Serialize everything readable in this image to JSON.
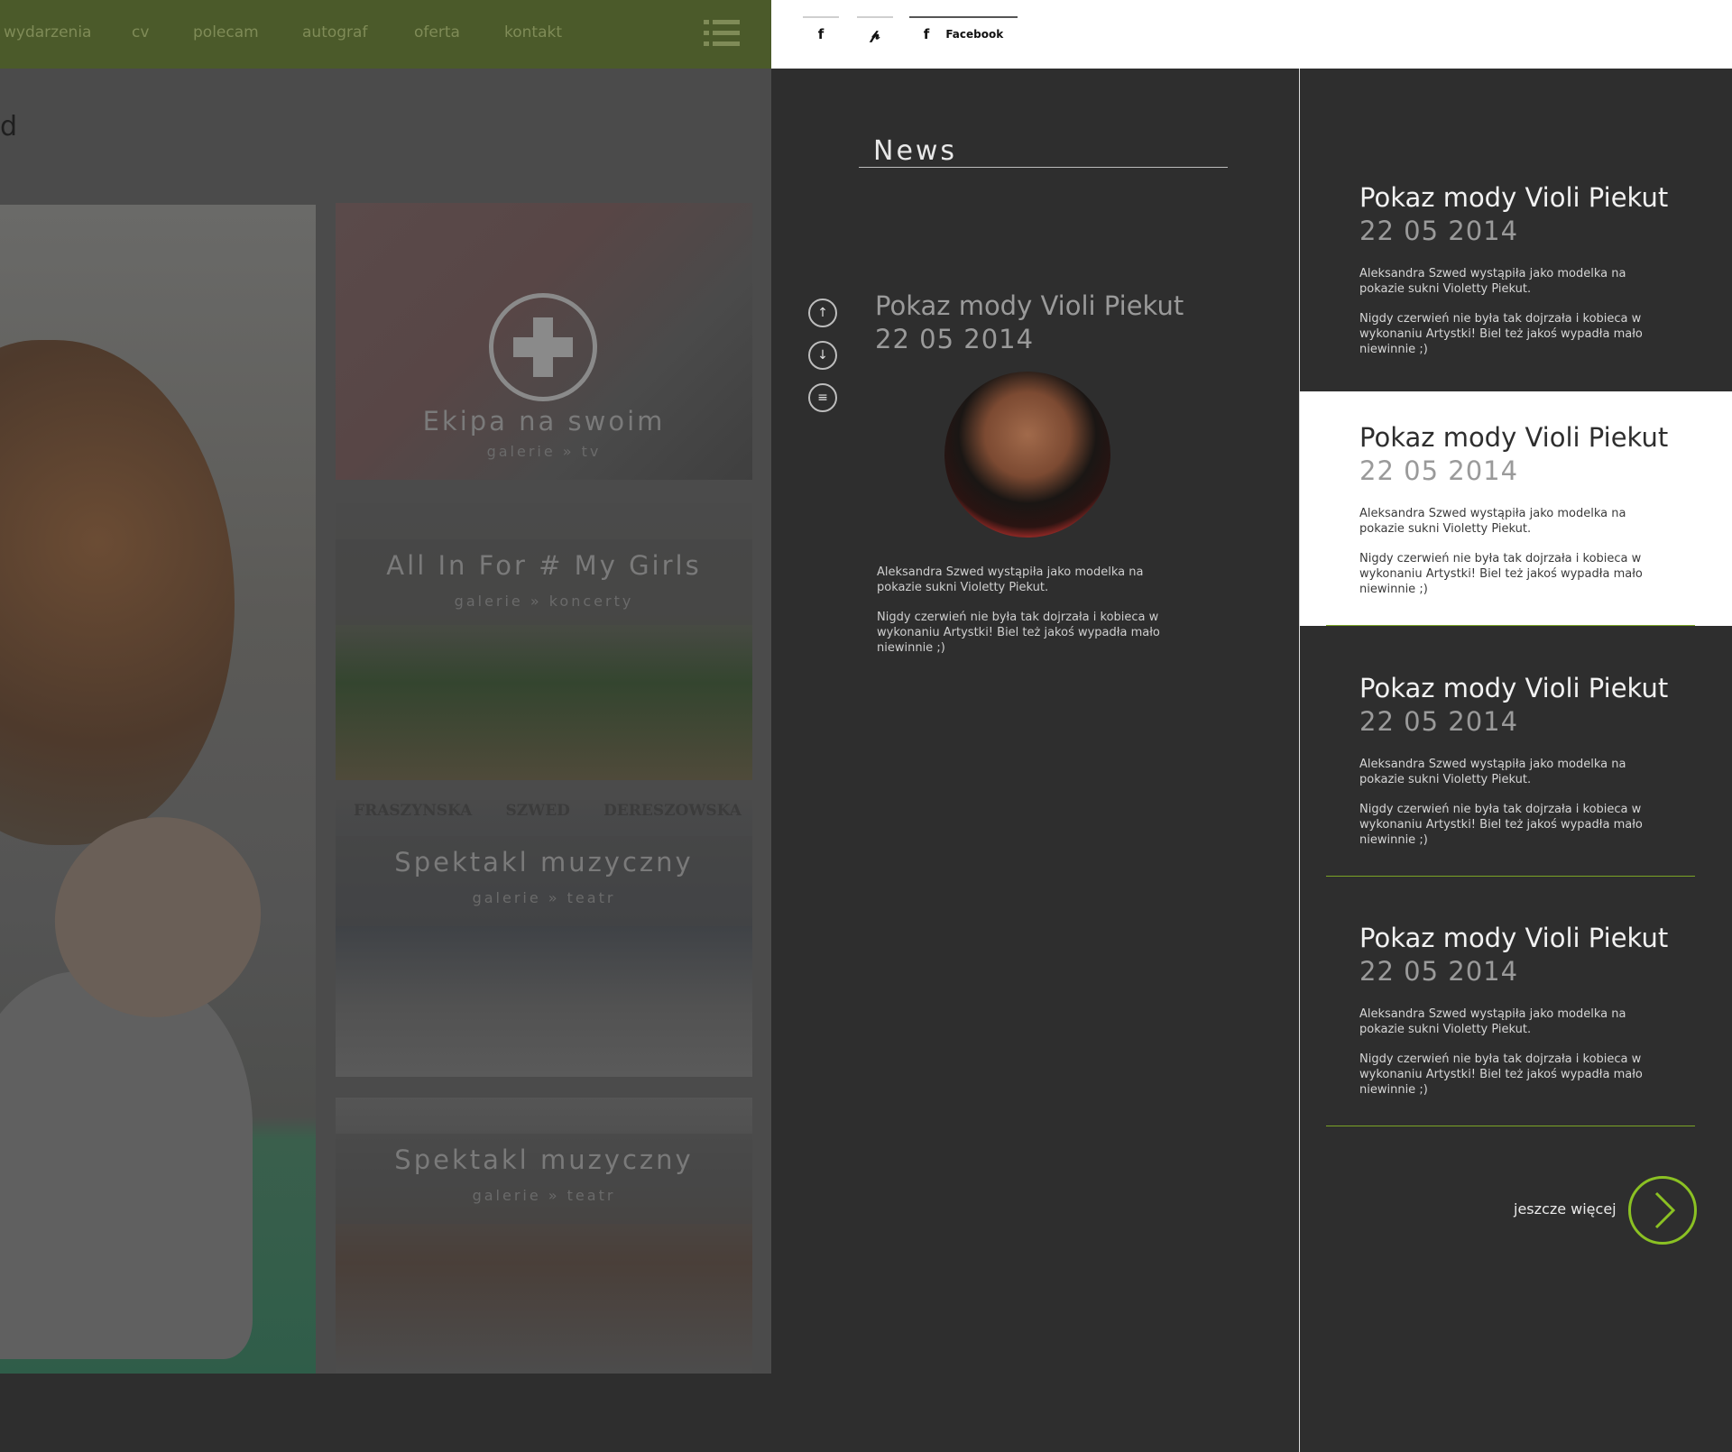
{
  "nav": {
    "items": [
      "wydarzenia",
      "cv",
      "polecam",
      "autograf",
      "oferta",
      "kontakt"
    ],
    "menu_icon": "hamburger-menu-icon",
    "accent_color": "#4b5a2a"
  },
  "page": {
    "heading_fragment": "d"
  },
  "tiles": [
    {
      "title": "Ekipa na swoim",
      "subtitle": "galerie » tv",
      "icon": "plus-icon"
    },
    {
      "title": "All In For # My Girls",
      "subtitle": "galerie » koncerty"
    },
    {
      "title": "Spektakl muzyczny",
      "subtitle": "galerie » teatr",
      "poster_names": [
        "FRASZYNSKA",
        "SZWED",
        "DERESZOWSKA"
      ]
    },
    {
      "title": "Spektakl muzyczny",
      "subtitle": "galerie » teatr"
    }
  ],
  "share": {
    "facebook_icon": "facebook-icon",
    "pinterest_icon": "pinterest-icon",
    "facebook_label": "Facebook"
  },
  "news": {
    "heading": "News",
    "controls": [
      "arrow-up-icon",
      "arrow-down-icon",
      "list-icon"
    ],
    "featured": {
      "title": "Pokaz mody Violi Piekut",
      "date": "22 05 2014",
      "p1": "Aleksandra Szwed wystąpiła jako modelka na pokazie sukni Violetty Piekut.",
      "p2": "Nigdy czerwień nie była tak dojrzała i kobieca w wykonaniu Artystki! Biel też jakoś wypadła mało niewinnie ;)"
    },
    "list": [
      {
        "title": "Pokaz mody Violi Piekut",
        "date": "22 05 2014",
        "p1": "Aleksandra Szwed wystąpiła jako modelka na pokazie sukni Violetty Piekut.",
        "p2": "Nigdy czerwień nie była tak dojrzała i kobieca w wykonaniu Artystki! Biel też jakoś wypadła mało niewinnie ;)",
        "active": false
      },
      {
        "title": "Pokaz mody Violi Piekut",
        "date": "22 05 2014",
        "p1": "Aleksandra Szwed wystąpiła jako modelka na pokazie sukni Violetty Piekut.",
        "p2": "Nigdy czerwień nie była tak dojrzała i kobieca w wykonaniu Artystki! Biel też jakoś wypadła mało niewinnie ;)",
        "active": true
      },
      {
        "title": "Pokaz mody Violi Piekut",
        "date": "22 05 2014",
        "p1": "Aleksandra Szwed wystąpiła jako modelka na pokazie sukni Violetty Piekut.",
        "p2": "Nigdy czerwień nie była tak dojrzała i kobieca w wykonaniu Artystki! Biel też jakoś wypadła mało niewinnie ;)",
        "active": false
      },
      {
        "title": "Pokaz mody Violi Piekut",
        "date": "22 05 2014",
        "p1": "Aleksandra Szwed wystąpiła jako modelka na pokazie sukni Violetty Piekut.",
        "p2": "Nigdy czerwień nie była tak dojrzała i kobieca w wykonaniu Artystki! Biel też jakoś wypadła mało niewinnie ;)",
        "active": false
      }
    ],
    "more_label": "jeszcze więcej",
    "more_icon": "chevron-right-icon",
    "accent_color": "#8bc123"
  }
}
